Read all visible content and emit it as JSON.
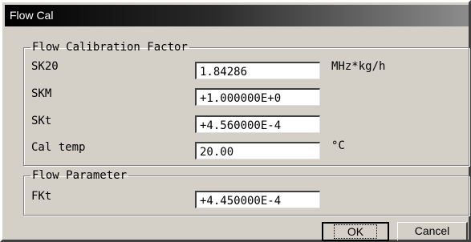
{
  "window": {
    "title": "Flow Cal"
  },
  "calibration": {
    "legend": "Flow Calibration Factor",
    "fields": [
      {
        "label": "SK20",
        "value": "1.84286",
        "unit": "MHz*kg/h"
      },
      {
        "label": "SKM",
        "value": "+1.000000E+0",
        "unit": ""
      },
      {
        "label": "SKt",
        "value": "+4.560000E-4",
        "unit": ""
      },
      {
        "label": "Cal temp",
        "value": "20.00",
        "unit": "°C"
      }
    ]
  },
  "parameter": {
    "legend": "Flow Parameter",
    "fields": [
      {
        "label": "FKt",
        "value": "+4.450000E-4"
      }
    ]
  },
  "buttons": {
    "ok": "OK",
    "cancel": "Cancel"
  }
}
